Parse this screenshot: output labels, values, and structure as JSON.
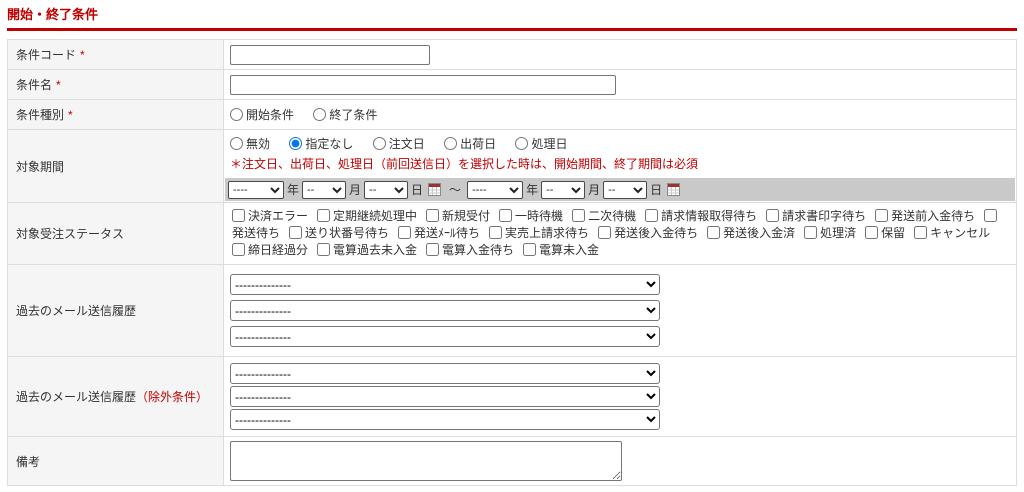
{
  "header": {
    "title": "開始・終了条件"
  },
  "colors": {
    "accent_red": "#c00000",
    "label_cell_bg": "#f5f5f5",
    "table_border": "#dddddd",
    "date_bar_bg": "#c9c9c9",
    "radio_checked": "#0b76ef"
  },
  "rows": {
    "condition_code": {
      "label": "条件コード",
      "required_mark": "*",
      "value": ""
    },
    "condition_name": {
      "label": "条件名",
      "required_mark": "*",
      "value": ""
    },
    "condition_type": {
      "label": "条件種別",
      "required_mark": "*",
      "options": [
        "開始条件",
        "終了条件"
      ]
    },
    "target_period": {
      "label": "対象期間",
      "options": [
        "無効",
        "指定なし",
        "注文日",
        "出荷日",
        "処理日"
      ],
      "selected": "指定なし",
      "note": "＊注文日、出荷日、処理日（前回送信日）を選択した時は、開始期間、終了期間は必須",
      "date_range": {
        "year_placeholder": "----",
        "month_placeholder": "--",
        "day_placeholder": "--",
        "year_unit": "年",
        "month_unit": "月",
        "day_unit": "日",
        "separator": "～"
      }
    },
    "order_status": {
      "label": "対象受注ステータス",
      "items": [
        "決済エラー",
        "定期継続処理中",
        "新規受付",
        "一時待機",
        "二次待機",
        "請求情報取得待ち",
        "請求書印字待ち",
        "発送前入金待ち",
        "発送待ち",
        "送り状番号待ち",
        "発送ﾒｰﾙ待ち",
        "実売上請求待ち",
        "発送後入金待ち",
        "発送後入金済",
        "処理済",
        "保留",
        "キャンセル",
        "締日経過分",
        "電算過去未入金",
        "電算入金待ち",
        "電算未入金"
      ]
    },
    "mail_history": {
      "label": "過去のメール送信履歴",
      "selects": [
        "--------------",
        "--------------",
        "--------------"
      ]
    },
    "mail_history_exclude": {
      "label": "過去のメール送信履歴",
      "label_suffix": "（除外条件）",
      "selects": [
        "--------------",
        "--------------",
        "--------------"
      ]
    },
    "remarks": {
      "label": "備考",
      "value": ""
    }
  }
}
